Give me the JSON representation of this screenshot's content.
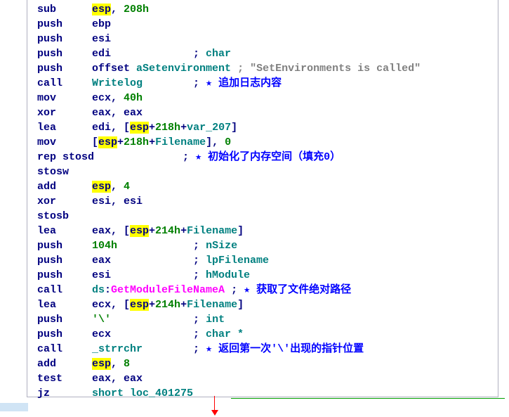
{
  "colors": {
    "keyword": "#000080",
    "highlight_bg": "#ffff00",
    "number": "#008000",
    "label": "#008080",
    "comment_gray": "#808080",
    "comment_blue": "#0000ff",
    "api_pink": "#ff00ff",
    "arrow_red": "#ff0000",
    "flow_green": "#00a000"
  },
  "code": [
    {
      "mn": "sub",
      "ops": [
        {
          "t": "esp",
          "c": "hl"
        },
        {
          "t": ", "
        },
        {
          "t": "208h",
          "c": "grn"
        }
      ]
    },
    {
      "mn": "push",
      "ops": [
        {
          "t": "ebp"
        }
      ]
    },
    {
      "mn": "push",
      "ops": [
        {
          "t": "esi"
        }
      ]
    },
    {
      "mn": "push",
      "ops": [
        {
          "t": "edi             "
        },
        {
          "t": ";",
          "c": "blu"
        },
        {
          "t": " char",
          "c": "lbl"
        }
      ]
    },
    {
      "mn": "push",
      "ops": [
        {
          "t": "offset",
          "c": "blu"
        },
        {
          "t": " "
        },
        {
          "t": "aSetenvironment",
          "c": "lbl"
        },
        {
          "t": " "
        },
        {
          "t": "; \"SetEnvironments is called\"",
          "c": "gry"
        }
      ]
    },
    {
      "mn": "call",
      "ops": [
        {
          "t": "Writelog",
          "c": "lbl"
        },
        {
          "t": "        "
        },
        {
          "t": ";",
          "c": "blu"
        },
        {
          "t": " ★",
          "c": "bstar"
        },
        {
          "t": " 追加日志内容",
          "c": "bstar"
        }
      ]
    },
    {
      "mn": "mov",
      "ops": [
        {
          "t": "ecx, "
        },
        {
          "t": "40h",
          "c": "grn"
        }
      ]
    },
    {
      "mn": "xor",
      "ops": [
        {
          "t": "eax, eax"
        }
      ]
    },
    {
      "mn": "lea",
      "ops": [
        {
          "t": "edi, ["
        },
        {
          "t": "esp",
          "c": "hl"
        },
        {
          "t": "+"
        },
        {
          "t": "218h",
          "c": "grn"
        },
        {
          "t": "+"
        },
        {
          "t": "var_207",
          "c": "lbl"
        },
        {
          "t": "]"
        }
      ]
    },
    {
      "mn": "mov",
      "ops": [
        {
          "t": "["
        },
        {
          "t": "esp",
          "c": "hl"
        },
        {
          "t": "+"
        },
        {
          "t": "218h",
          "c": "grn"
        },
        {
          "t": "+"
        },
        {
          "t": "Filename",
          "c": "lbl"
        },
        {
          "t": "], "
        },
        {
          "t": "0",
          "c": "grn"
        }
      ]
    },
    {
      "mn": "rep stosd",
      "full": true,
      "ops": [
        {
          "t": "              "
        },
        {
          "t": ";",
          "c": "blu"
        },
        {
          "t": " ★",
          "c": "bstar"
        },
        {
          "t": " 初始化了内存空间（填充0）",
          "c": "bstar"
        }
      ]
    },
    {
      "mn": "stosw",
      "ops": []
    },
    {
      "mn": "add",
      "ops": [
        {
          "t": "esp",
          "c": "hl"
        },
        {
          "t": ", "
        },
        {
          "t": "4",
          "c": "grn"
        }
      ]
    },
    {
      "mn": "xor",
      "ops": [
        {
          "t": "esi, esi"
        }
      ]
    },
    {
      "mn": "stosb",
      "ops": []
    },
    {
      "mn": "lea",
      "ops": [
        {
          "t": "eax, ["
        },
        {
          "t": "esp",
          "c": "hl"
        },
        {
          "t": "+"
        },
        {
          "t": "214h",
          "c": "grn"
        },
        {
          "t": "+"
        },
        {
          "t": "Filename",
          "c": "lbl"
        },
        {
          "t": "]"
        }
      ]
    },
    {
      "mn": "push",
      "ops": [
        {
          "t": "104h",
          "c": "grn"
        },
        {
          "t": "            "
        },
        {
          "t": ";",
          "c": "blu"
        },
        {
          "t": " nSize",
          "c": "lbl"
        }
      ]
    },
    {
      "mn": "push",
      "ops": [
        {
          "t": "eax             "
        },
        {
          "t": ";",
          "c": "blu"
        },
        {
          "t": " lpFilename",
          "c": "lbl"
        }
      ]
    },
    {
      "mn": "push",
      "ops": [
        {
          "t": "esi             "
        },
        {
          "t": ";",
          "c": "blu"
        },
        {
          "t": " hModule",
          "c": "lbl"
        }
      ]
    },
    {
      "mn": "call",
      "ops": [
        {
          "t": "ds",
          "c": "lbl"
        },
        {
          "t": ":"
        },
        {
          "t": "GetModuleFileNameA",
          "c": "pnk"
        },
        {
          "t": " "
        },
        {
          "t": ";",
          "c": "blu"
        },
        {
          "t": " ★",
          "c": "bstar"
        },
        {
          "t": " 获取了文件绝对路径",
          "c": "bstar"
        }
      ]
    },
    {
      "mn": "lea",
      "ops": [
        {
          "t": "ecx, ["
        },
        {
          "t": "esp",
          "c": "hl"
        },
        {
          "t": "+"
        },
        {
          "t": "214h",
          "c": "grn"
        },
        {
          "t": "+"
        },
        {
          "t": "Filename",
          "c": "lbl"
        },
        {
          "t": "]"
        }
      ]
    },
    {
      "mn": "push",
      "ops": [
        {
          "t": "'\\'",
          "c": "grn"
        },
        {
          "t": "             "
        },
        {
          "t": ";",
          "c": "blu"
        },
        {
          "t": " int",
          "c": "lbl"
        }
      ]
    },
    {
      "mn": "push",
      "ops": [
        {
          "t": "ecx             "
        },
        {
          "t": ";",
          "c": "blu"
        },
        {
          "t": " char *",
          "c": "lbl"
        }
      ]
    },
    {
      "mn": "call",
      "ops": [
        {
          "t": "_strrchr",
          "c": "lbl"
        },
        {
          "t": "        "
        },
        {
          "t": ";",
          "c": "blu"
        },
        {
          "t": " ★",
          "c": "bstar"
        },
        {
          "t": " 返回第一次'\\'出现的指针位置",
          "c": "bstar"
        }
      ]
    },
    {
      "mn": "add",
      "ops": [
        {
          "t": "esp",
          "c": "hl"
        },
        {
          "t": ", "
        },
        {
          "t": "8",
          "c": "grn"
        }
      ]
    },
    {
      "mn": "test",
      "ops": [
        {
          "t": "eax, eax"
        }
      ]
    },
    {
      "mn": "jz",
      "ops": [
        {
          "t": "short loc_401275",
          "c": "lbl"
        }
      ]
    }
  ],
  "chart_data": null
}
